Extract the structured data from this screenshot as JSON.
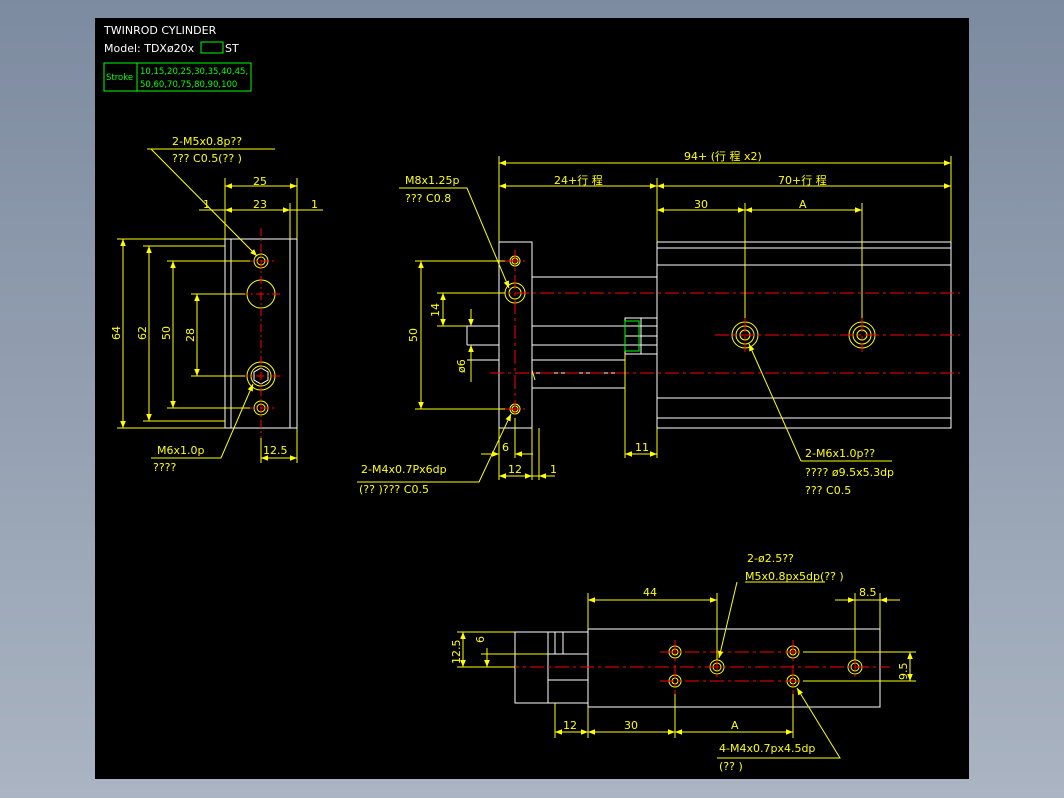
{
  "colors": {
    "background": "#000000",
    "outline": "#ffffff",
    "dimension": "#ffff00",
    "centerline": "#ff0000",
    "title_box": "#00ff00"
  },
  "header": {
    "title": "TWINROD CYLINDER",
    "model_prefix": "Model: TDXø20x",
    "model_suffix": "ST",
    "stroke_label": "Stroke",
    "stroke_values_line1": "10,15,20,25,30,35,40,45,",
    "stroke_values_line2": "50,60,70,75,80,90,100"
  },
  "left_view": {
    "note_port_line1": "2-M5x0.8p??",
    "note_port_line2": "???  C0.5(??  )",
    "dim_25": "25",
    "dim_23": "23",
    "dim_1_left": "1",
    "dim_1_right": "1",
    "dim_64": "64",
    "dim_62": "62",
    "dim_50": "50",
    "dim_28": "28",
    "dim_12_5": "12.5",
    "note_m6_line1": "M6x1.0p",
    "note_m6_line2": "????"
  },
  "front_view": {
    "dim_total": "94+ (行 程 x2)",
    "dim_24": "24+行 程",
    "dim_70": "70+行 程",
    "dim_30": "30",
    "dim_A": "A",
    "note_m8_line1": "M8x1.25p",
    "note_m8_line2": "???   C0.8",
    "dim_50": "50",
    "dim_14": "14",
    "dim_phi6": "ø6",
    "dim_6": "6",
    "dim_12": "12",
    "dim_1": "1",
    "dim_11": "11",
    "note_m4_line1": "2-M4x0.7Px6dp",
    "note_m4_line2": "(??  )???   C0.5",
    "note_m6_line1": "2-M6x1.0p??",
    "note_m6_line2": "????     ø9.5x5.3dp",
    "note_m6_line3": "???    C0.5"
  },
  "bottom_view": {
    "note_phi_line1": "2-ø2.5??",
    "note_phi_line2": "M5x0.8px5dp(??  )",
    "dim_44": "44",
    "dim_8_5": "8.5",
    "dim_12_5": "12.5",
    "dim_6": "6",
    "dim_9_5": "9.5",
    "dim_12": "12",
    "dim_30": "30",
    "dim_A": "A",
    "note_m4_line1": "4-M4x0.7px4.5dp",
    "note_m4_line2": "(??  )"
  }
}
